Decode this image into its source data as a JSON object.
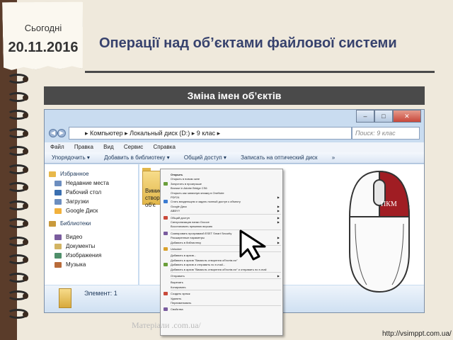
{
  "header": {
    "today_label": "Сьогодні",
    "date": "20.11.2016",
    "title": "Операції над об’єктами файлової системи",
    "subtitle": "Зміна імен об’єктів"
  },
  "window": {
    "caption_buttons": [
      "–",
      "□",
      "✕"
    ],
    "address": "▸ Компьютер ▸ Локальный диск (D:) ▸ 9 клас ▸",
    "search_placeholder": "Поиск: 9 клас",
    "menu": [
      "Файл",
      "Правка",
      "Вид",
      "Сервис",
      "Справка"
    ],
    "toolbar": [
      "Упорядочить ▾",
      "Добавить в библиотеку ▾",
      "Общий доступ ▾",
      "Записать на оптический диск",
      "»"
    ],
    "sidebar": [
      {
        "label": "Избранное",
        "icon": "star-icon",
        "color": "#e8b84a"
      },
      {
        "label": "Недавние места",
        "icon": "recent-icon",
        "color": "#6c8ebf"
      },
      {
        "label": "Рабочий стол",
        "icon": "desktop-icon",
        "color": "#3a6fb0"
      },
      {
        "label": "Загрузки",
        "icon": "downloads-icon",
        "color": "#6c8ebf"
      },
      {
        "label": "Google Диск",
        "icon": "google-drive-icon",
        "color": "#f2b13c"
      },
      {
        "label": "Библиотеки",
        "icon": "libraries-icon",
        "color": "#c99a3c"
      },
      {
        "label": "Видео",
        "icon": "video-icon",
        "color": "#7a5c9e"
      },
      {
        "label": "Документы",
        "icon": "documents-icon",
        "color": "#d2b463"
      },
      {
        "label": "Изображения",
        "icon": "images-icon",
        "color": "#4f8f6a"
      },
      {
        "label": "Музыка",
        "icon": "music-icon",
        "color": "#b86b3a"
      }
    ],
    "folder_label": "Вимисл створені об’є",
    "status": "Элемент: 1"
  },
  "context_menu": {
    "items": [
      {
        "label": "Открыть",
        "bold": true
      },
      {
        "label": "Открыть в новом окне"
      },
      {
        "label": "Запустить в проигрыше"
      },
      {
        "label": "Browse in Adobe Bridge CS6"
      },
      {
        "label": "Открыть как записную книжку в OneNote"
      },
      {
        "label": "PDF24",
        "submenu": true
      },
      {
        "label": "Стать владельцем и задать полный доступ к объекту"
      },
      {
        "label": "Google Диск",
        "submenu": true
      },
      {
        "label": "ABBYY",
        "submenu": true
      },
      {
        "sep": true
      },
      {
        "label": "Общий доступ",
        "submenu": true
      },
      {
        "label": "Синхронизация папки Groove",
        "submenu": true
      },
      {
        "label": "Восстановить прежнюю версию"
      },
      {
        "sep": true
      },
      {
        "label": "Сканировать программой ESET Smart Security"
      },
      {
        "label": "Расширенные параметры",
        "submenu": true
      },
      {
        "label": "Добавить в библиотеку",
        "submenu": true
      },
      {
        "sep": true
      },
      {
        "label": "Unlocker"
      },
      {
        "sep": true
      },
      {
        "label": "Добавить в архив..."
      },
      {
        "label": "Добавить в архив \"Вимисль створення об’єктів.rar\""
      },
      {
        "label": "Добавить в архив и отправить по e-mail..."
      },
      {
        "label": "Добавить в архив \"Вимисль створення об’єктів.rar\" и отправить по e-mail"
      },
      {
        "sep": true
      },
      {
        "label": "Отправить",
        "submenu": true
      },
      {
        "sep": true
      },
      {
        "label": "Вырезать"
      },
      {
        "label": "Копировать"
      },
      {
        "sep": true
      },
      {
        "label": "Создать ярлык"
      },
      {
        "label": "Удалить"
      },
      {
        "label": "Переименовать"
      },
      {
        "sep": true
      },
      {
        "label": "Свойства"
      }
    ]
  },
  "mouse_label": "ПКМ",
  "footer": {
    "watermark": "Матеріали                                         .com.ua/",
    "url": "http://vsimppt.com.ua/"
  },
  "colors": {
    "title": "#37426d",
    "banner": "#4a4a4a",
    "mouse_right_button": "#a01d23"
  }
}
